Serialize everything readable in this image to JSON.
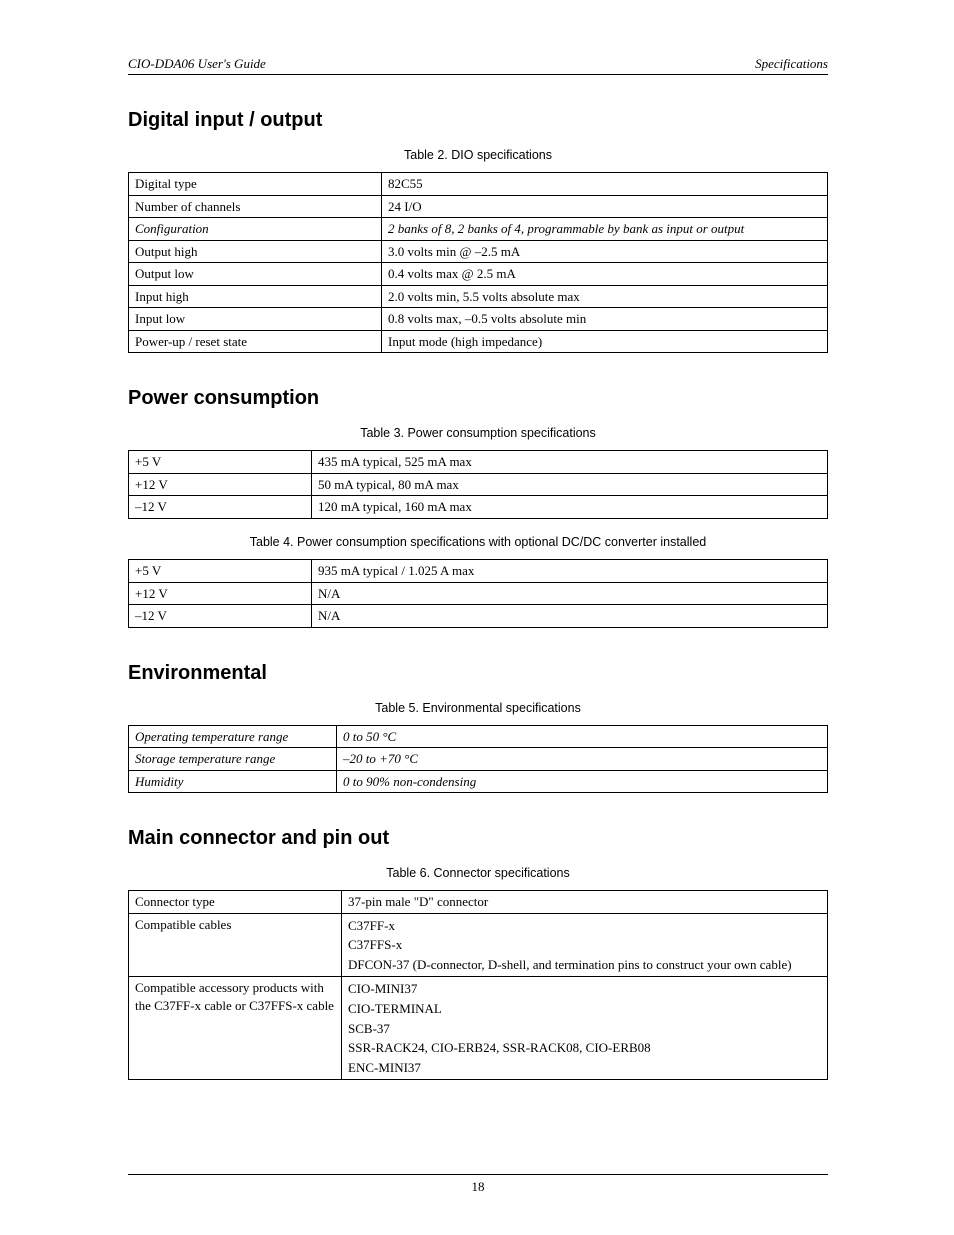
{
  "header": {
    "left": "CIO-DDA06 User's Guide",
    "right": "Specifications"
  },
  "sections": {
    "dio": {
      "heading": "Digital input / output",
      "caption": "Table 2. DIO specifications",
      "rows": [
        {
          "k": "Digital type",
          "v": "82C55"
        },
        {
          "k": "Number of channels",
          "v": "24 I/O"
        },
        {
          "k": "Configuration",
          "v": "2 banks of 8, 2 banks of 4, programmable by bank as input or output",
          "ik": true,
          "iv": true
        },
        {
          "k": "Output high",
          "v": "3.0 volts min @ –2.5 mA"
        },
        {
          "k": "Output low",
          "v": "0.4 volts max @ 2.5 mA"
        },
        {
          "k": "Input high",
          "v": "2.0 volts min, 5.5 volts absolute max"
        },
        {
          "k": "Input low",
          "v": "0.8 volts max, –0.5 volts absolute min"
        },
        {
          "k": "Power-up / reset state",
          "v": "Input mode (high impedance)"
        }
      ]
    },
    "power": {
      "heading": "Power consumption",
      "caption1": "Table 3. Power consumption specifications",
      "rows1": [
        {
          "k": "+5 V",
          "v": "435 mA typical, 525 mA max"
        },
        {
          "k": "+12 V",
          "v": "50 mA typical, 80 mA max"
        },
        {
          "k": "–12 V",
          "v": "120 mA typical, 160 mA max"
        }
      ],
      "caption2": "Table 4. Power consumption specifications with optional DC/DC converter installed",
      "rows2": [
        {
          "k": "+5 V",
          "v": "935 mA typical /  1.025 A max"
        },
        {
          "k": "+12 V",
          "v": "N/A"
        },
        {
          "k": "–12 V",
          "v": "N/A"
        }
      ]
    },
    "env": {
      "heading": "Environmental",
      "caption": "Table 5. Environmental specifications",
      "rows": [
        {
          "k": "Operating temperature range",
          "v": "0 to 50 °C"
        },
        {
          "k": "Storage temperature range",
          "v": "–20 to +70 °C"
        },
        {
          "k": "Humidity",
          "v": "0 to 90% non-condensing"
        }
      ]
    },
    "conn": {
      "heading": "Main connector and pin out",
      "caption": "Table 6. Connector specifications",
      "rows": [
        {
          "k": "Connector type",
          "v": "37-pin male \"D\" connector"
        },
        {
          "k": "Compatible cables",
          "lines": [
            "C37FF-x",
            "C37FFS-x",
            "DFCON-37 (D-connector, D-shell, and termination pins to construct your own cable)"
          ]
        },
        {
          "k": "Compatible accessory products with the C37FF-x cable or C37FFS-x cable",
          "lines": [
            "CIO-MINI37",
            "CIO-TERMINAL",
            "SCB-37",
            "SSR-RACK24, CIO-ERB24, SSR-RACK08, CIO-ERB08",
            "ENC-MINI37"
          ]
        }
      ]
    }
  },
  "footer": {
    "page": "18"
  }
}
